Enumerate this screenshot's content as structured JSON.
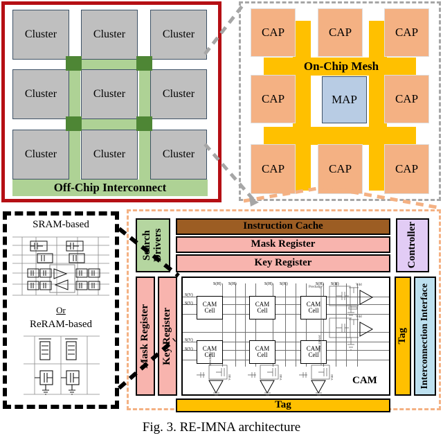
{
  "figure": {
    "caption": "Fig. 3.  RE-IMNA architecture",
    "colors": {
      "cluster_fill": "#bfbfbf",
      "interconnect_green": "#aed295",
      "mesh_node_green": "#4e8635",
      "panel_a_border": "#b50f14",
      "cap_orange": "#f4b183",
      "map_blue": "#b8cce4",
      "bus_yellow": "#ffc000",
      "instruction_cache_brown": "#9c5d23",
      "register_pink": "#f8b4ae",
      "search_drivers_green": "#b5d6a0",
      "controller_purple": "#e2ccf5",
      "interface_blue": "#bde0ef"
    }
  },
  "panel_a": {
    "name": "Cluster array / off-chip level",
    "cluster_label": "Cluster",
    "clusters": [
      "Cluster",
      "Cluster",
      "Cluster",
      "Cluster",
      "Cluster",
      "Cluster",
      "Cluster",
      "Cluster",
      "Cluster"
    ],
    "interconnect_label": "Off-Chip Interconnect"
  },
  "panel_b": {
    "name": "Cluster detail / on-chip mesh",
    "mesh_label": "On-Chip Mesh",
    "tiles": [
      {
        "label": "CAP",
        "type": "cap"
      },
      {
        "label": "CAP",
        "type": "cap"
      },
      {
        "label": "CAP",
        "type": "cap"
      },
      {
        "label": "CAP",
        "type": "cap"
      },
      {
        "label": "MAP",
        "type": "map"
      },
      {
        "label": "CAP",
        "type": "cap"
      },
      {
        "label": "CAP",
        "type": "cap"
      },
      {
        "label": "CAP",
        "type": "cap"
      },
      {
        "label": "CAP",
        "type": "cap"
      }
    ]
  },
  "panel_c": {
    "name": "CAP internal architecture",
    "search_drivers": "Search Drivers",
    "instruction_cache": "Instruction Cache",
    "mask_register_top": "Mask Register",
    "key_register_top": "Key Register",
    "controller": "Controller",
    "mask_register_side": "Mask Register",
    "key_register_side": "Key Register",
    "tag_side": "Tag",
    "tag_bottom": "Tag",
    "interconnection_interface": "Interconnection Interface",
    "cam_label": "CAM",
    "cam_cell_label_line1": "CAM",
    "cam_cell_label_line2": "Cell",
    "search_h_label": "S(H)",
    "search_v_label": "S(V)",
    "precharge_label": "Precharge",
    "write_driver_label": "Write Driver",
    "vdd_label": "Vdd",
    "sense_amp_label": "SA",
    "sh_labels": [
      "S(H)",
      "S(H)",
      "S(H)",
      "S(H)",
      "S(H)",
      "S(H)"
    ],
    "sv_labels": [
      "S(V)",
      "S(V)",
      "S(V)",
      "S(V)"
    ]
  },
  "panel_d": {
    "name": "CAM cell implementations",
    "sram_title": "SRAM-based",
    "or_label": "Or",
    "reram_title": "ReRAM-based"
  }
}
